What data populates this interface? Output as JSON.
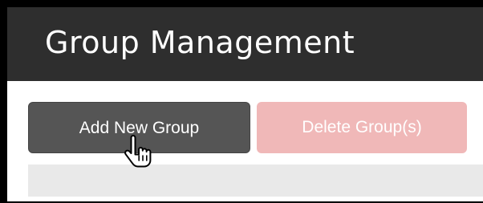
{
  "header": {
    "title": "Group Management"
  },
  "toolbar": {
    "add_label": "Add New Group",
    "delete_label": "Delete Group(s)"
  },
  "icons": {
    "cursor": "hand-pointer-icon"
  },
  "colors": {
    "header_bg": "#2e2e2e",
    "add_button_bg": "#555555",
    "delete_button_bg": "#f0b8b8",
    "frame": "#000000"
  }
}
